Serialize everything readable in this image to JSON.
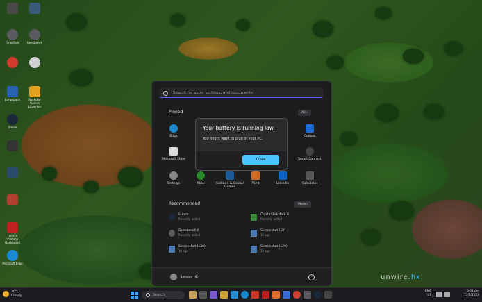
{
  "desktop": {
    "icons": [
      {
        "label": "",
        "color": "#4a4a4a"
      },
      {
        "label": "Fix pitfalls",
        "color": "#5a5a60"
      },
      {
        "label": "",
        "color": "#d03a2a"
      },
      {
        "label": "Jumpspace",
        "color": "#2a60b0"
      },
      {
        "label": "Steam",
        "color": "#1b2838"
      },
      {
        "label": "",
        "color": "#333"
      },
      {
        "label": "",
        "color": "#2a4a6a"
      },
      {
        "label": "",
        "color": "#b04030"
      },
      {
        "label": "Lenovo Vantage Dashboard",
        "color": "#c02020"
      },
      {
        "label": "Microsoft Edge",
        "color": "#1a8ad0"
      }
    ],
    "icons_col2": [
      {
        "label": "",
        "color": "#3a5a7a"
      },
      {
        "label": "Geekbench",
        "color": "#5a5a60"
      },
      {
        "label": "",
        "color": "#d0d0d0"
      },
      {
        "label": "Rockstar Games Launcher",
        "color": "#e0a020"
      }
    ]
  },
  "start_menu": {
    "search_placeholder": "Search for apps, settings, and documents",
    "pinned_title": "Pinned",
    "all_button": "All  ›",
    "pinned_apps": [
      {
        "label": "Edge",
        "icon": "edge-icon",
        "color": "#1a8ad0"
      },
      {
        "label": "Outlook",
        "icon": "outlook-icon",
        "color": "#1a6ad0"
      },
      {
        "label": "Microsoft Store",
        "icon": "store-icon",
        "color": "#ddd"
      },
      {
        "label": "Smart Connect",
        "icon": "smart-connect-icon",
        "color": "#444"
      },
      {
        "label": "Settings",
        "icon": "settings-icon",
        "color": "#888"
      },
      {
        "label": "Xbox",
        "icon": "xbox-icon",
        "color": "#2a8a2a"
      },
      {
        "label": "Solitaire & Casual Games",
        "icon": "solitaire-icon",
        "color": "#1a5a9a"
      },
      {
        "label": "Paint",
        "icon": "paint-icon",
        "color": "#d06a20"
      },
      {
        "label": "LinkedIn",
        "icon": "linkedin-icon",
        "color": "#0a66c2"
      },
      {
        "label": "Calculator",
        "icon": "calculator-icon",
        "color": "#555"
      }
    ],
    "recommended_title": "Recommended",
    "more_button": "More  ›",
    "recommended": [
      {
        "title": "Steam",
        "sub": "Recently added",
        "color": "#1b2838"
      },
      {
        "title": "CrystalDiskMark 8",
        "sub": "Recently added",
        "color": "#3a8a3a"
      },
      {
        "title": "Geekbench 6",
        "sub": "Recently added",
        "color": "#5a5a60"
      },
      {
        "title": "Screenshot (10)",
        "sub": "1h ago",
        "color": "#4a7ab0"
      },
      {
        "title": "Screenshot (130)",
        "sub": "1h ago",
        "color": "#4a7ab0"
      },
      {
        "title": "Screenshot (129)",
        "sub": "1h ago",
        "color": "#4a7ab0"
      }
    ],
    "user_name": "Lenovo HK"
  },
  "dialog": {
    "title": "Your battery is running low.",
    "message": "You might want to plug in your PC.",
    "close_label": "Close"
  },
  "taskbar": {
    "weather_temp": "20°C",
    "weather_desc": "Cloudy",
    "search_label": "Search",
    "tray_lang": "ENG",
    "tray_region": "US",
    "time": "3:01 pm",
    "date": "17/4/2023"
  },
  "watermark": {
    "prefix": "unwire",
    "suffix": ".hk"
  }
}
